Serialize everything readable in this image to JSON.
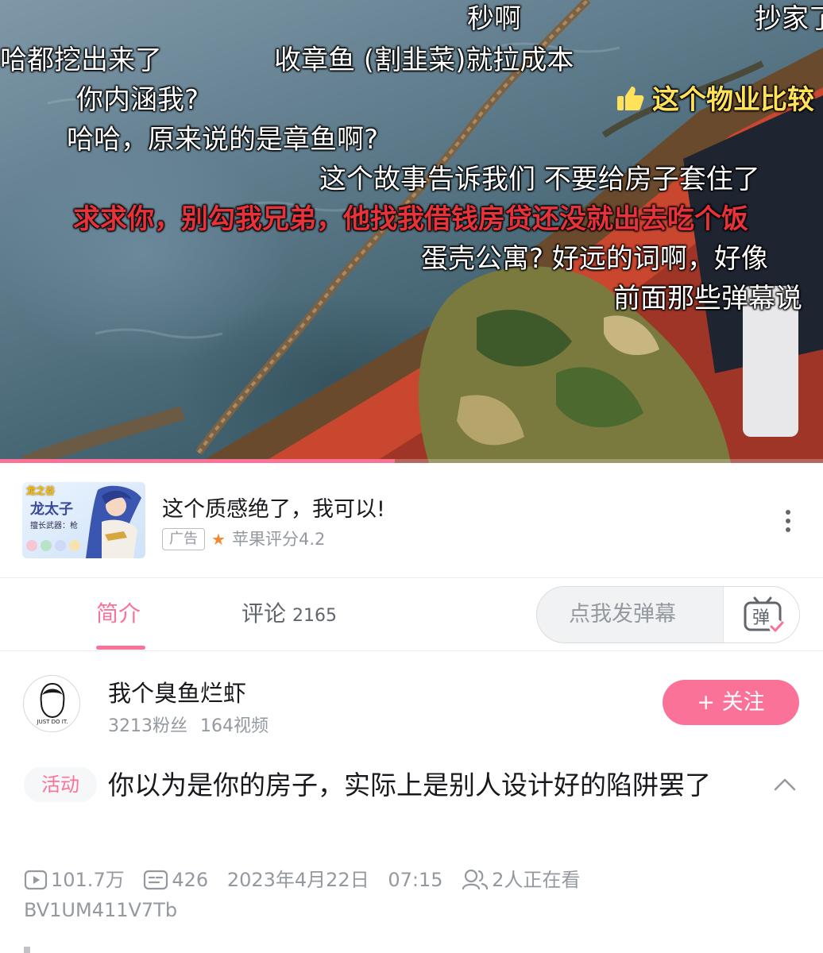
{
  "video": {
    "progress": 0.48,
    "danmaku": [
      {
        "text": "秒啊",
        "style": "white"
      },
      {
        "text": "抄家了",
        "style": "white"
      },
      {
        "text": "哈都挖出来了",
        "style": "white"
      },
      {
        "text": "收章鱼 (割韭菜)就拉成本",
        "style": "white"
      },
      {
        "text": "你内涵我?",
        "style": "white"
      },
      {
        "text": "这个物业比较",
        "style": "yellow",
        "icon": "thumbs-up-icon"
      },
      {
        "text": "哈哈，原来说的是章鱼啊?",
        "style": "white"
      },
      {
        "text": "这个故事告诉我们 不要给房子套住了",
        "style": "white"
      },
      {
        "text": "求求你，别勾我兄弟，他找我借钱房贷还没就出去吃个饭",
        "style": "red"
      },
      {
        "text": "蛋壳公寓? 好远的词啊，好像",
        "style": "white"
      },
      {
        "text": "前面那些弹幕说",
        "style": "white"
      }
    ]
  },
  "ad": {
    "thumb_logo": "龙之谷",
    "thumb_hero": "龙太子",
    "thumb_sub": "擅长武器：枪",
    "title": "这个质感绝了，我可以!",
    "tag": "广告",
    "rating": "苹果评分4.2",
    "star_color": "#f28a33"
  },
  "tabs": {
    "intro": "简介",
    "comments": "评论",
    "comments_count": "2165",
    "danmaku_placeholder": "点我发弹幕",
    "danmaku_button": "弹"
  },
  "uploader": {
    "name": "我个臭鱼烂虾",
    "avatar_text": "JUST DO IT.",
    "fans": "3213粉丝",
    "videos": "164视频",
    "follow": "+ 关注"
  },
  "title": {
    "tag": "活动",
    "text": "你以为是你的房子，实际上是别人设计好的陷阱罢了"
  },
  "meta": {
    "views": "101.7万",
    "danmaku_count": "426",
    "date": "2023年4月22日",
    "time": "07:15",
    "watching": "2人正在看",
    "bvid": "BV1UM411V7Tb"
  },
  "colors": {
    "accent": "#fb7299",
    "text": "#18191c",
    "muted": "#9499a0",
    "danmaku_red": "#e8323a",
    "danmaku_yellow": "#ffe25a"
  }
}
